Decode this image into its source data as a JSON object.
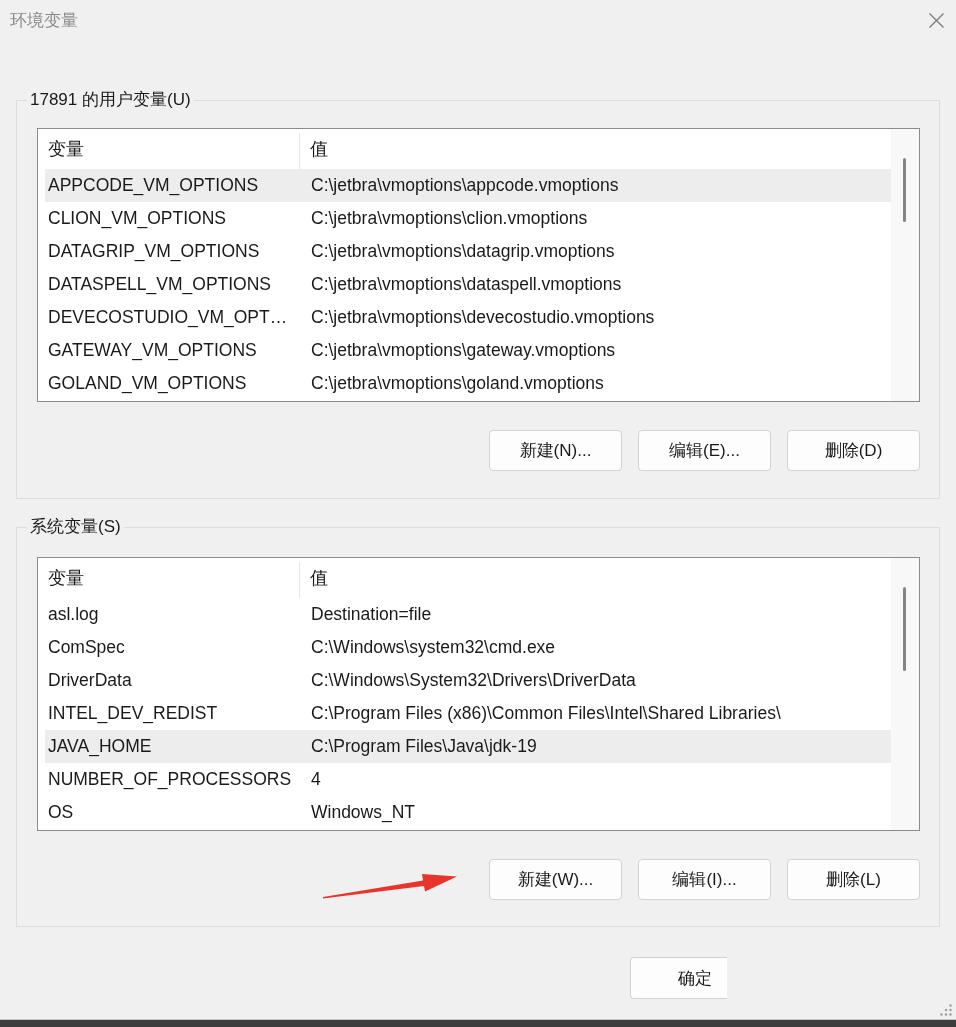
{
  "window": {
    "title": "环境变量"
  },
  "user_variables": {
    "label": "17891 的用户变量(U)",
    "columns": [
      "变量",
      "值"
    ],
    "rows": [
      {
        "name": "APPCODE_VM_OPTIONS",
        "value": "C:\\jetbra\\vmoptions\\appcode.vmoptions",
        "selected": true
      },
      {
        "name": "CLION_VM_OPTIONS",
        "value": "C:\\jetbra\\vmoptions\\clion.vmoptions",
        "selected": false
      },
      {
        "name": "DATAGRIP_VM_OPTIONS",
        "value": "C:\\jetbra\\vmoptions\\datagrip.vmoptions",
        "selected": false
      },
      {
        "name": "DATASPELL_VM_OPTIONS",
        "value": "C:\\jetbra\\vmoptions\\dataspell.vmoptions",
        "selected": false
      },
      {
        "name": "DEVECOSTUDIO_VM_OPT…",
        "value": "C:\\jetbra\\vmoptions\\devecostudio.vmoptions",
        "selected": false
      },
      {
        "name": "GATEWAY_VM_OPTIONS",
        "value": "C:\\jetbra\\vmoptions\\gateway.vmoptions",
        "selected": false
      },
      {
        "name": "GOLAND_VM_OPTIONS",
        "value": "C:\\jetbra\\vmoptions\\goland.vmoptions",
        "selected": false
      }
    ],
    "buttons": [
      "新建(N)...",
      "编辑(E)...",
      "删除(D)"
    ]
  },
  "system_variables": {
    "label": "系统变量(S)",
    "columns": [
      "变量",
      "值"
    ],
    "rows": [
      {
        "name": "asl.log",
        "value": "Destination=file",
        "selected": false
      },
      {
        "name": "ComSpec",
        "value": "C:\\Windows\\system32\\cmd.exe",
        "selected": false
      },
      {
        "name": "DriverData",
        "value": "C:\\Windows\\System32\\Drivers\\DriverData",
        "selected": false
      },
      {
        "name": "INTEL_DEV_REDIST",
        "value": "C:\\Program Files (x86)\\Common Files\\Intel\\Shared Libraries\\",
        "selected": false
      },
      {
        "name": "JAVA_HOME",
        "value": "C:\\Program Files\\Java\\jdk-19",
        "selected": true
      },
      {
        "name": "NUMBER_OF_PROCESSORS",
        "value": "4",
        "selected": false
      },
      {
        "name": "OS",
        "value": "Windows_NT",
        "selected": false
      }
    ],
    "buttons": [
      "新建(W)...",
      "编辑(I)...",
      "删除(L)"
    ],
    "annotation": {
      "kind": "arrow"
    }
  },
  "footer": {
    "buttons": [
      "确定"
    ]
  }
}
